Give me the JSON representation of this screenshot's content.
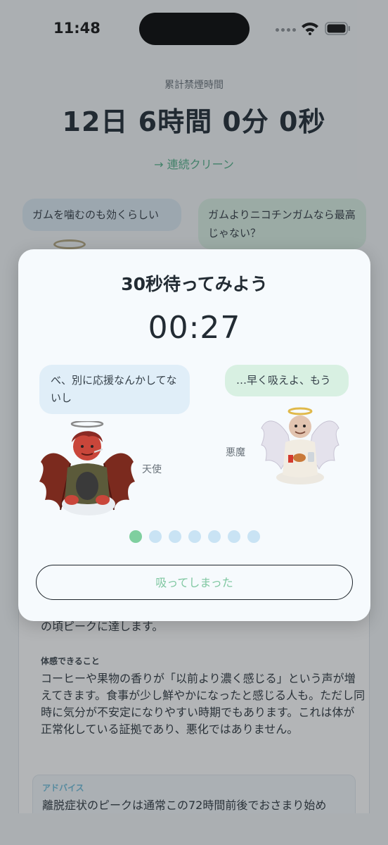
{
  "status_bar": {
    "time": "11:48"
  },
  "background": {
    "label": "累計禁煙時間",
    "elapsed": "12日 6時間 0分 0秒",
    "streak_link": "→ 連続クリーン",
    "bubble_left": "ガムを噛むのも効くらしい",
    "bubble_right": "ガムよりニコチンガムなら最高じゃない？",
    "card_line": "の頃ピークに達します。",
    "experience_heading": "体感できること",
    "experience_text": "コーヒーや果物の香りが「以前より濃く感じる」という声が増えてきます。食事が少し鮮やかになったと感じる人も。ただし同時に気分が不安定になりやすい時期でもあります。これは体が正常化している証拠であり、悪化ではありません。",
    "advice_heading": "アドバイス",
    "advice_text": "離脱症状のピークは通常この72時間前後でおさまり始め"
  },
  "modal": {
    "title": "30秒待ってみよう",
    "timer": "00:27",
    "bubble_left": "べ、別に応援なんかしてないし",
    "bubble_right": "…早く吸えよ、もう",
    "label_left": "天使",
    "label_right": "悪魔",
    "dots_total": 7,
    "dots_active_index": 0,
    "button_label": "吸ってしまった"
  },
  "colors": {
    "accent_green": "#7fcf9f",
    "dot_inactive": "#c9e3f4",
    "bubble_blue": "#e0eef8",
    "bubble_green": "#d8f0e2"
  }
}
